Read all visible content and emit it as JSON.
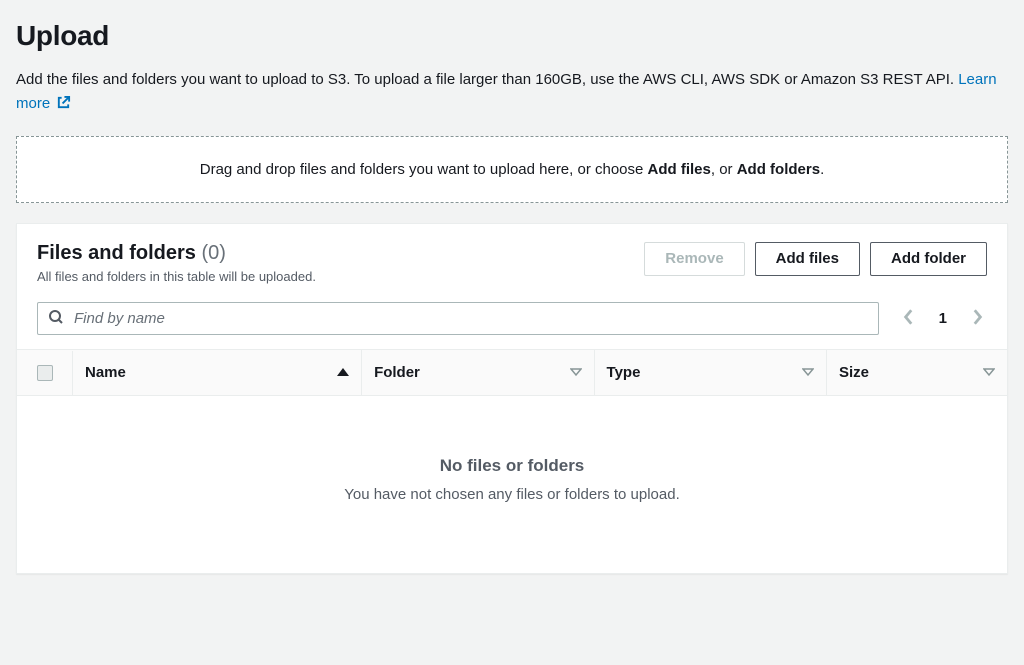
{
  "page_title": "Upload",
  "description": "Add the files and folders you want to upload to S3. To upload a file larger than 160GB, use the AWS CLI, AWS SDK or Amazon S3 REST API. ",
  "learn_more_text": "Learn more",
  "dropzone": {
    "prefix": "Drag and drop files and folders you want to upload here, or choose ",
    "add_files_bold": "Add files",
    "separator": ", or ",
    "add_folders_bold": "Add folders",
    "suffix": "."
  },
  "panel": {
    "title": "Files and folders",
    "count_text": "(0)",
    "subtitle": "All files and folders in this table will be uploaded.",
    "actions": {
      "remove": "Remove",
      "add_files": "Add files",
      "add_folder": "Add folder"
    },
    "search_placeholder": "Find by name",
    "pager": {
      "current": "1"
    },
    "columns": {
      "name": "Name",
      "folder": "Folder",
      "type": "Type",
      "size": "Size"
    },
    "empty": {
      "title": "No files or folders",
      "subtitle": "You have not chosen any files or folders to upload."
    }
  }
}
